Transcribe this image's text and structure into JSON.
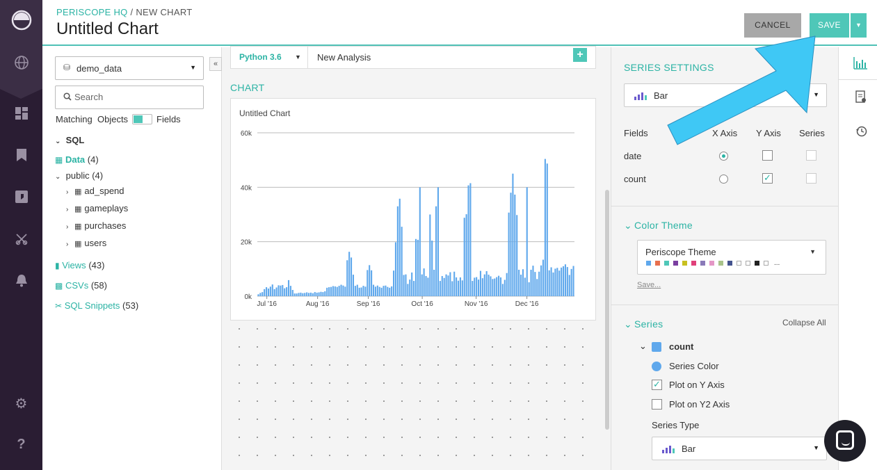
{
  "header": {
    "breadcrumb_org": "PERISCOPE HQ",
    "breadcrumb_sep": " / ",
    "breadcrumb_page": "NEW CHART",
    "title": "Untitled Chart",
    "cancel_label": "CANCEL",
    "save_label": "SAVE"
  },
  "nav": {
    "icons": [
      "logo-icon",
      "globe-icon",
      "dashboard-icon",
      "bookmark-icon",
      "chat-icon",
      "scissors-icon",
      "bell-icon",
      "settings-gear-icon",
      "help-icon"
    ]
  },
  "browser": {
    "database": "demo_data",
    "search_placeholder": "Search",
    "matching": "Matching",
    "objects": "Objects",
    "fields": "Fields",
    "sql": "SQL",
    "data_label": "Data",
    "data_count": "(4)",
    "public_label": "public",
    "public_count": "(4)",
    "tables": [
      "ad_spend",
      "gameplays",
      "purchases",
      "users"
    ],
    "views_label": "Views",
    "views_count": "(43)",
    "csvs_label": "CSVs",
    "csvs_count": "(58)",
    "snippets_label": "SQL Snippets",
    "snippets_count": "(53)"
  },
  "editor": {
    "language": "Python 3.6",
    "analysis_name": "New Analysis",
    "chart_section": "CHART",
    "chart_title": "Untitled Chart"
  },
  "chart_data": {
    "type": "bar",
    "title": "Untitled Chart",
    "xlabel": "",
    "ylabel": "",
    "ylim": [
      0,
      60000
    ],
    "yticks": [
      "0k",
      "20k",
      "40k",
      "60k"
    ],
    "xticks": [
      "Jul '16",
      "Aug '16",
      "Sep '16",
      "Oct '16",
      "Nov '16",
      "Dec '16"
    ],
    "grid": true,
    "color": "#5fa8ec",
    "series": [
      {
        "name": "count",
        "values": [
          700,
          1200,
          1500,
          2600,
          3300,
          2800,
          3500,
          4300,
          2600,
          3200,
          4000,
          3900,
          4100,
          2900,
          3300,
          5900,
          3800,
          2300,
          1000,
          1000,
          1200,
          1300,
          1100,
          1200,
          1400,
          1200,
          1300,
          1100,
          1500,
          1300,
          1400,
          1600,
          1500,
          1800,
          3100,
          3300,
          3400,
          3700,
          3600,
          3400,
          3800,
          4200,
          3900,
          3500,
          13200,
          16300,
          14200,
          7900,
          3800,
          4200,
          3100,
          3200,
          3800,
          3500,
          9600,
          11400,
          9500,
          4200,
          3500,
          3900,
          3400,
          3100,
          3800,
          3900,
          3400,
          3100,
          3600,
          9400,
          19800,
          33000,
          35800,
          25500,
          7800,
          8000,
          4500,
          6100,
          8700,
          5600,
          21000,
          20700,
          40000,
          8000,
          10200,
          7400,
          6800,
          30000,
          20400,
          9700,
          33000,
          40000,
          5600,
          7400,
          6700,
          8000,
          7600,
          8800,
          5500,
          9000,
          6900,
          5700,
          6900,
          5800,
          28800,
          30100,
          40700,
          41500,
          5600,
          6800,
          7000,
          6100,
          9300,
          6600,
          8000,
          9200,
          7900,
          7300,
          6300,
          6500,
          7000,
          7500,
          6900,
          4500,
          6000,
          8500,
          30700,
          38000,
          45000,
          37300,
          29800,
          9700,
          7900,
          9900,
          6800,
          40000,
          5100,
          9700,
          11200,
          8900,
          6300,
          9000,
          11300,
          13400,
          50400,
          48700,
          9500,
          10600,
          8700,
          10100,
          10400,
          9400,
          10500,
          11000,
          11700,
          10700,
          7800,
          10000,
          11100
        ]
      }
    ]
  },
  "settings": {
    "series_settings_title": "SERIES SETTINGS",
    "chart_type": "Bar",
    "fields_head": "Fields",
    "x_axis_head": "X Axis",
    "y_axis_head": "Y Axis",
    "series_head": "Series",
    "field_rows": [
      "date",
      "count"
    ],
    "color_theme_title": "Color Theme",
    "theme_name": "Periscope Theme",
    "theme_swatches": [
      "#5fa8ec",
      "#e8704e",
      "#4fc7b8",
      "#7b3fa0",
      "#c8c020",
      "#e0407a",
      "#8a7ab8",
      "#e497c6",
      "#a9c38a",
      "#44538e",
      "#ffffff",
      "#ffffff",
      "#222222",
      "#ffffff"
    ],
    "theme_more": "...",
    "save_link": "Save...",
    "series_title": "Series",
    "collapse_all": "Collapse All",
    "series_name": "count",
    "series_color_label": "Series Color",
    "plot_y": "Plot on Y Axis",
    "plot_y2": "Plot on Y2 Axis",
    "series_type_label": "Series Type",
    "series_type": "Bar"
  }
}
